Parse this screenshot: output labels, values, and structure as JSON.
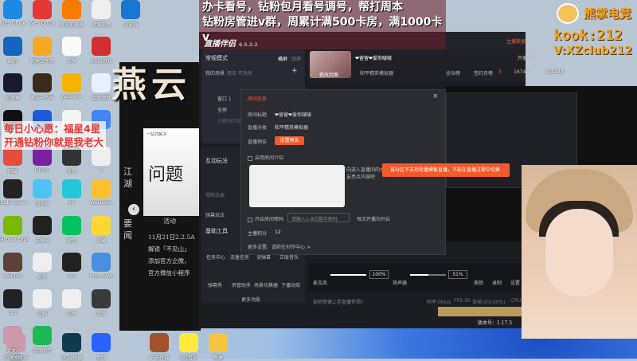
{
  "overlay": {
    "caption_line1": "办卡看号，钻粉包月看号调号，帮打周本",
    "caption_line2": "钻粉房管进v群，周累计满500卡房，满1000卡v",
    "wish_line1": "每日小心愿：福星4星",
    "wish_line2": "开通钻粉你就是我老大",
    "logo_name": "熊掌电竞",
    "logo_kook": "kook:212",
    "logo_v": "V:XZclub212"
  },
  "desktop_icons": [
    "WPS Office",
    "WPS Office",
    "腾讯加速器",
    "资源工具",
    "浏览器",
    "酷狗",
    "新建文件夹",
    "文件",
    "4399游戏",
    "UU加速器",
    "加速器",
    "燕云十六声",
    "WeGame",
    "百度网盘",
    "音频",
    "剪映专业版",
    "Wallpaper Engine",
    "PDF文件",
    "APK",
    "炉石传说",
    "网易",
    "Origin",
    "设置",
    "1",
    "QQ音乐",
    "Studio One 6",
    "浏览器",
    "mb",
    "WeGame",
    "新建",
    "GeForce Experience",
    "三角洲",
    "微信",
    "收藏",
    "网易云音乐",
    "WeChat",
    "文件",
    "QQ",
    "HBS_RAW",
    "新建",
    "QQ",
    "文档",
    "文件",
    "游戏",
    "美女1",
    "美女2",
    "游戏助手"
  ],
  "game": {
    "calligraphy": "燕云",
    "card_title": "问题",
    "card_sub": "一站式解决",
    "side1": "江湖",
    "side2": "要闻",
    "activity": "活动",
    "lines": [
      "11月21日2.2.5A",
      "解锁「不见山」",
      "添加官方企微，",
      "官方微信小程序"
    ]
  },
  "app": {
    "name": "直播伴侣",
    "version": "6.5.3.2",
    "mode": "常规模式",
    "orient_h": "横屏",
    "orient_v": "竖屏",
    "scenes_label": "我的场景",
    "scenes_hint": "双击 可改名",
    "scenes": [
      "窗口 1",
      "全屏",
      "三角洲行动"
    ],
    "interactive_title": "互动玩法",
    "interactive": [
      "视频连麦",
      "弹幕玩法"
    ],
    "tools_title": "基础工具",
    "tools": [
      "任务中心",
      "流量任务",
      "读弹幕",
      "正版音乐",
      "弹幕秀",
      "房管助手",
      "场景切换器",
      "下播动效"
    ],
    "more": "更多功能",
    "room_title": "❤留留❤爱你啵啵",
    "change_cover": "修改封面",
    "category": "和平精英模拟器",
    "rank": "全站榜",
    "sign_month": "签约月榜",
    "sign_num": "3",
    "likes": "167425",
    "fans": "100444",
    "start_label": "开播提醒",
    "data_btn": "主播数据"
  },
  "dialog": {
    "title": "房间信息",
    "room_title_label": "房间标题",
    "room_title_value": "❤留留❤爱你啵啵",
    "category_label": "直播分类",
    "category_value": "和平精英模拟器",
    "notice_label": "直播预告",
    "notice_btn": "设置预告",
    "intro_checkbox": "启用房间介绍",
    "intro_hint": "向进入直播间的水友亮点内容吧",
    "password_checkbox": "开启房间密码",
    "password_placeholder": "请输入1-8位数字密码",
    "password_note": "每次开播均开启",
    "score_label": "主播积分",
    "score_value": "12",
    "more": "更多设置，请前往创作中心 >"
  },
  "toast": "该分区不支持轮播模板直播，不能在直播过程中切换",
  "audio": {
    "mic_label": "麦克风",
    "mic_level": 100,
    "mic_pct": "100%",
    "speaker_label": "扬声器",
    "speaker_level": 51,
    "speaker_pct": "51%",
    "beauty": "美颜",
    "record": "录制",
    "settings": "设置"
  },
  "status": {
    "help": "如何快速上手直播伴侣?",
    "bitrate": "码率:0kb/s",
    "fps": "FPS:30",
    "drop": "丢帧:0(0.00%)",
    "cpu": "CPU"
  },
  "version_label": "版本号：1.17.5"
}
